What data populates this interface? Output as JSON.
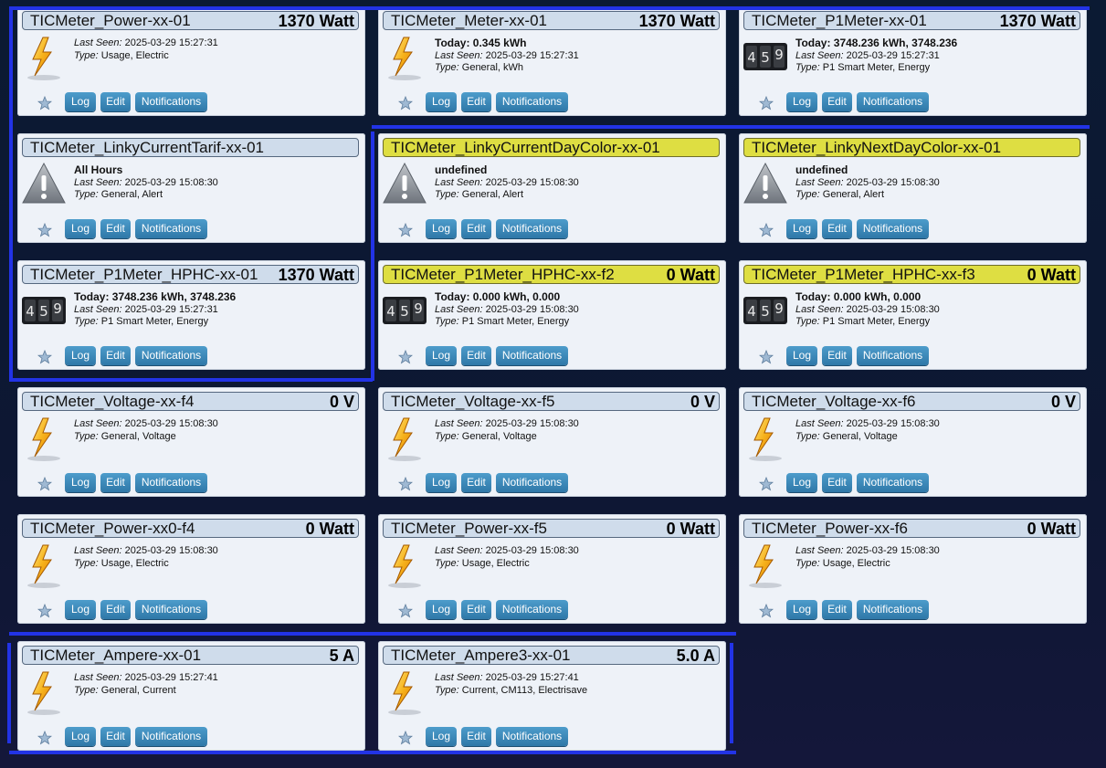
{
  "labels": {
    "last_seen": "Last Seen:",
    "type": "Type:",
    "log": "Log",
    "edit": "Edit",
    "notifications": "Notifications"
  },
  "colors": {
    "title_default": "#cfdceb",
    "title_highlight": "#dede42",
    "button": "#3a87b9",
    "divider": "#2233e6"
  },
  "devices": [
    {
      "name": "TICMeter_Power-xx-01",
      "value": "1370 Watt",
      "status": "",
      "last_seen": "2025-03-29 15:27:31",
      "type": "Usage, Electric",
      "icon": "lightning-icon",
      "highlight": false
    },
    {
      "name": "TICMeter_Meter-xx-01",
      "value": "1370 Watt",
      "status": "Today: 0.345 kWh",
      "last_seen": "2025-03-29 15:27:31",
      "type": "General, kWh",
      "icon": "lightning-icon",
      "highlight": false
    },
    {
      "name": "TICMeter_P1Meter-xx-01",
      "value": "1370 Watt",
      "status": "Today: 3748.236 kWh, 3748.236",
      "last_seen": "2025-03-29 15:27:31",
      "type": "P1 Smart Meter, Energy",
      "icon": "meter-counter-icon",
      "highlight": false
    },
    {
      "name": "TICMeter_LinkyCurrentTarif-xx-01",
      "value": "",
      "status": "All Hours",
      "last_seen": "2025-03-29 15:08:30",
      "type": "General, Alert",
      "icon": "alert-icon",
      "highlight": false
    },
    {
      "name": "TICMeter_LinkyCurrentDayColor-xx-01",
      "value": "",
      "status": "undefined",
      "last_seen": "2025-03-29 15:08:30",
      "type": "General, Alert",
      "icon": "alert-icon",
      "highlight": true
    },
    {
      "name": "TICMeter_LinkyNextDayColor-xx-01",
      "value": "",
      "status": "undefined",
      "last_seen": "2025-03-29 15:08:30",
      "type": "General, Alert",
      "icon": "alert-icon",
      "highlight": true
    },
    {
      "name": "TICMeter_P1Meter_HPHC-xx-01",
      "value": "1370 Watt",
      "status": "Today: 3748.236 kWh, 3748.236",
      "last_seen": "2025-03-29 15:27:31",
      "type": "P1 Smart Meter, Energy",
      "icon": "meter-counter-icon",
      "highlight": false
    },
    {
      "name": "TICMeter_P1Meter_HPHC-xx-f2",
      "value": "0 Watt",
      "status": "Today: 0.000 kWh, 0.000",
      "last_seen": "2025-03-29 15:08:30",
      "type": "P1 Smart Meter, Energy",
      "icon": "meter-counter-icon",
      "highlight": true
    },
    {
      "name": "TICMeter_P1Meter_HPHC-xx-f3",
      "value": "0 Watt",
      "status": "Today: 0.000 kWh, 0.000",
      "last_seen": "2025-03-29 15:08:30",
      "type": "P1 Smart Meter, Energy",
      "icon": "meter-counter-icon",
      "highlight": true
    },
    {
      "name": "TICMeter_Voltage-xx-f4",
      "value": "0 V",
      "status": "",
      "last_seen": "2025-03-29 15:08:30",
      "type": "General, Voltage",
      "icon": "lightning-icon",
      "highlight": false
    },
    {
      "name": "TICMeter_Voltage-xx-f5",
      "value": "0 V",
      "status": "",
      "last_seen": "2025-03-29 15:08:30",
      "type": "General, Voltage",
      "icon": "lightning-icon",
      "highlight": false
    },
    {
      "name": "TICMeter_Voltage-xx-f6",
      "value": "0 V",
      "status": "",
      "last_seen": "2025-03-29 15:08:30",
      "type": "General, Voltage",
      "icon": "lightning-icon",
      "highlight": false
    },
    {
      "name": "TICMeter_Power-xx0-f4",
      "value": "0 Watt",
      "status": "",
      "last_seen": "2025-03-29 15:08:30",
      "type": "Usage, Electric",
      "icon": "lightning-icon",
      "highlight": false
    },
    {
      "name": "TICMeter_Power-xx-f5",
      "value": "0 Watt",
      "status": "",
      "last_seen": "2025-03-29 15:08:30",
      "type": "Usage, Electric",
      "icon": "lightning-icon",
      "highlight": false
    },
    {
      "name": "TICMeter_Power-xx-f6",
      "value": "0 Watt",
      "status": "",
      "last_seen": "2025-03-29 15:08:30",
      "type": "Usage, Electric",
      "icon": "lightning-icon",
      "highlight": false
    },
    {
      "name": "TICMeter_Ampere-xx-01",
      "value": "5 A",
      "status": "",
      "last_seen": "2025-03-29 15:27:41",
      "type": "General, Current",
      "icon": "lightning-icon",
      "highlight": false
    },
    {
      "name": "TICMeter_Ampere3-xx-01",
      "value": "5.0 A",
      "status": "",
      "last_seen": "2025-03-29 15:27:41",
      "type": "Current, CM113, Electrisave",
      "icon": "lightning-icon",
      "highlight": false
    }
  ]
}
